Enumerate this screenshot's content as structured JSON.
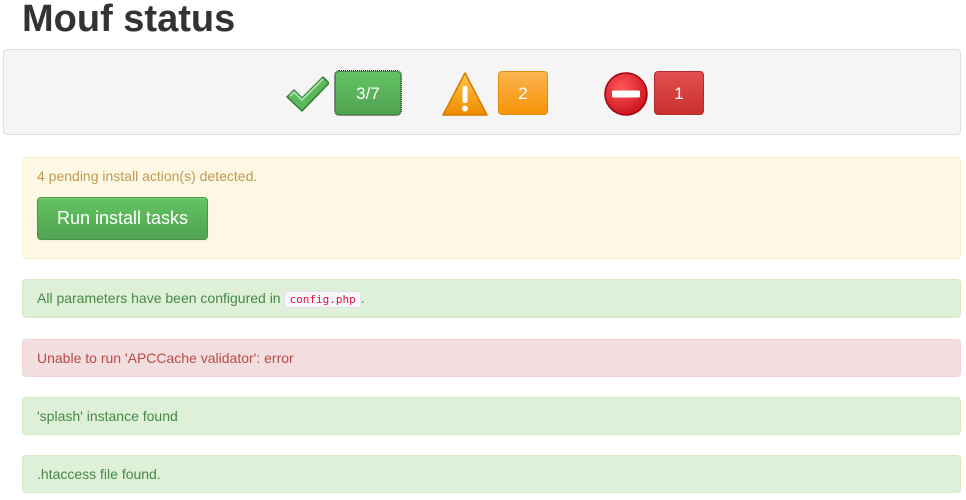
{
  "page": {
    "title": "Mouf status"
  },
  "status": {
    "success": {
      "icon": "checkmark-icon",
      "count": "3/7",
      "color": "#51a351"
    },
    "warning": {
      "icon": "warning-icon",
      "count": "2",
      "color": "#f89406"
    },
    "error": {
      "icon": "stop-icon",
      "count": "1",
      "color": "#c9302c"
    }
  },
  "install": {
    "message": "4 pending install action(s) detected.",
    "button_label": "Run install tasks"
  },
  "messages": {
    "params_prefix": "All parameters have been configured in",
    "params_file": "config.php",
    "params_suffix": ".",
    "apc_error": "Unable to run 'APCCache validator': error",
    "splash": "'splash' instance found",
    "htaccess": ".htaccess file found."
  }
}
